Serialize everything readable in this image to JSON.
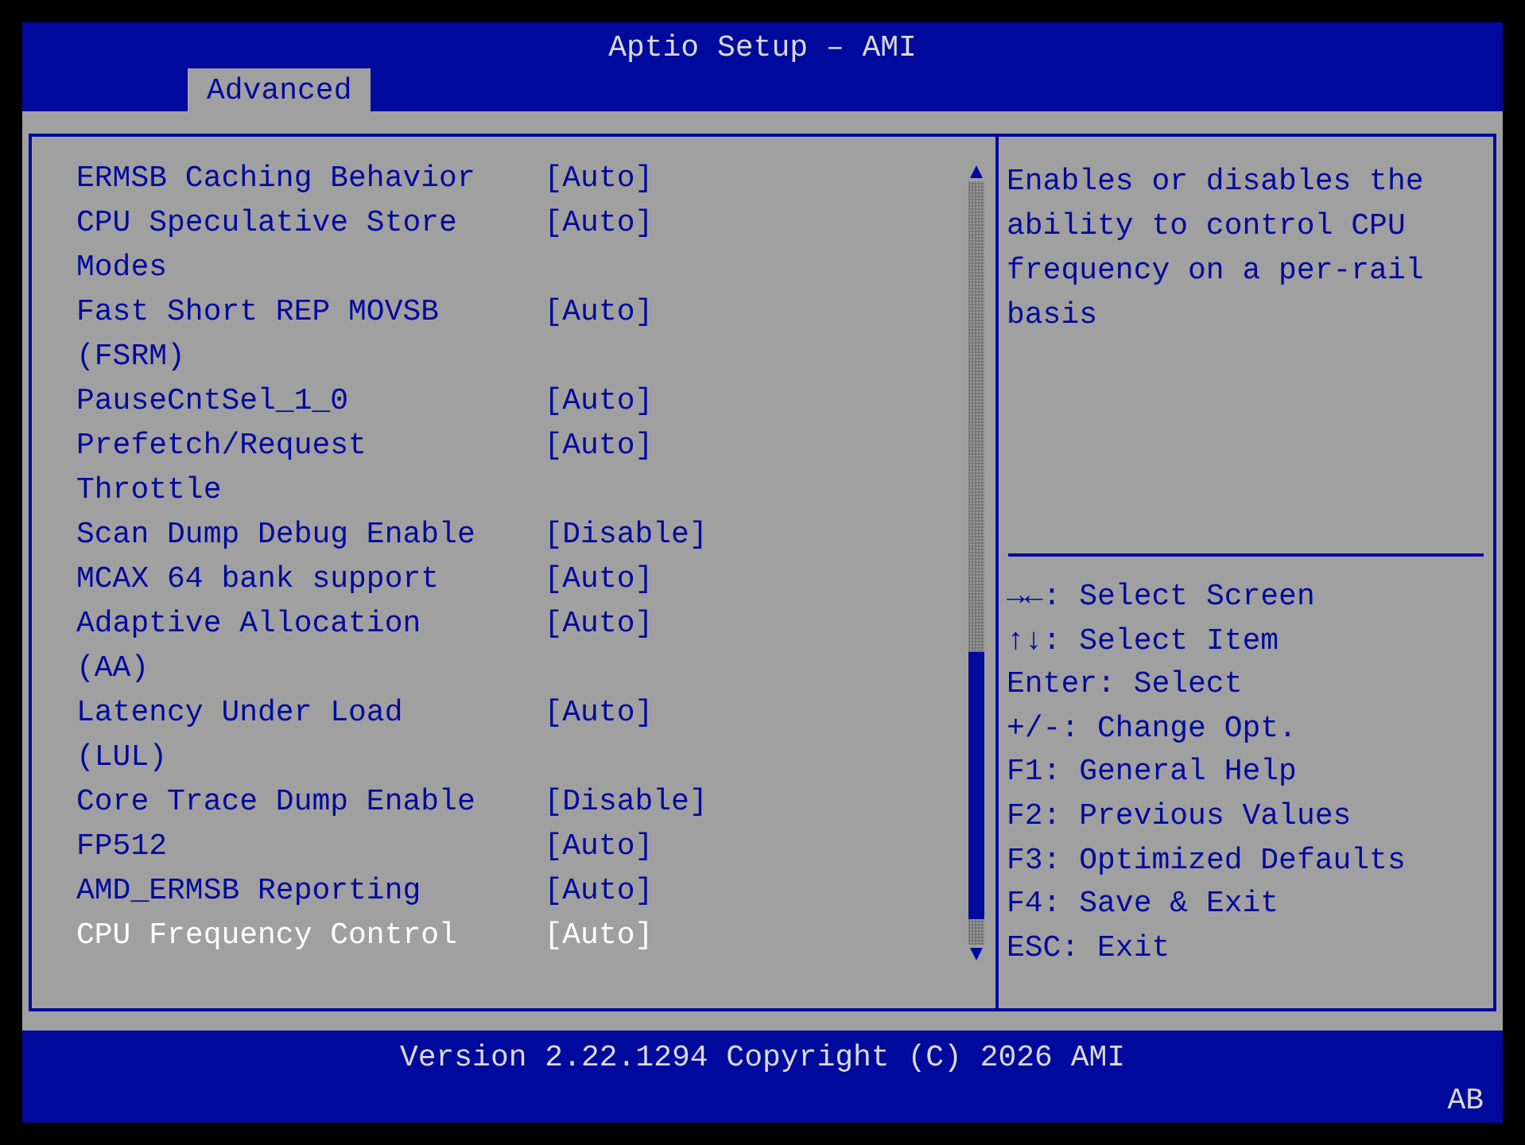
{
  "window": {
    "title": "Aptio Setup – AMI"
  },
  "tabs": [
    {
      "label": "Advanced",
      "selected": true
    }
  ],
  "settings": [
    {
      "label": "ERMSB Caching Behavior",
      "value": "[Auto]",
      "selected": false
    },
    {
      "label": "CPU Speculative Store Modes",
      "value": "[Auto]",
      "selected": false
    },
    {
      "label": "Fast Short REP MOVSB (FSRM)",
      "value": "[Auto]",
      "selected": false
    },
    {
      "label": "PauseCntSel_1_0",
      "value": "[Auto]",
      "selected": false
    },
    {
      "label": "Prefetch/Request Throttle",
      "value": "[Auto]",
      "selected": false
    },
    {
      "label": "Scan Dump Debug Enable",
      "value": "[Disable]",
      "selected": false
    },
    {
      "label": "MCAX 64 bank support",
      "value": "[Auto]",
      "selected": false
    },
    {
      "label": "Adaptive Allocation (AA)",
      "value": "[Auto]",
      "selected": false
    },
    {
      "label": "Latency Under Load (LUL)",
      "value": "[Auto]",
      "selected": false
    },
    {
      "label": "Core Trace Dump Enable",
      "value": "[Disable]",
      "selected": false
    },
    {
      "label": "FP512",
      "value": "[Auto]",
      "selected": false
    },
    {
      "label": "AMD_ERMSB Reporting",
      "value": "[Auto]",
      "selected": false
    },
    {
      "label": "CPU Frequency Control",
      "value": "[Auto]",
      "selected": true
    }
  ],
  "help_text": "Enables or disables the ability to control CPU frequency on a per-rail basis",
  "key_hints": [
    {
      "key": "→←:",
      "action": "Select Screen",
      "bold_key": false
    },
    {
      "key": "↑↓:",
      "action": "Select Item",
      "bold_key": false
    },
    {
      "key": "Enter:",
      "action": "Select",
      "bold_key": false
    },
    {
      "key": "+/-:",
      "action": "Change Opt.",
      "bold_key": false
    },
    {
      "key": "F1:",
      "action": "General Help",
      "bold_key": false
    },
    {
      "key": "F2:",
      "action": "Previous Values",
      "bold_key": false
    },
    {
      "key": "F3:",
      "action": "Optimized Defaults",
      "bold_key": false
    },
    {
      "key": "F4:",
      "action": "Save & Exit",
      "bold_key": false
    },
    {
      "key": "ESC:",
      "action": "Exit",
      "bold_key": false
    }
  ],
  "status_bar": {
    "version": "Version 2.22.1294 Copyright (C) 2026 AMI",
    "code": "AB"
  }
}
